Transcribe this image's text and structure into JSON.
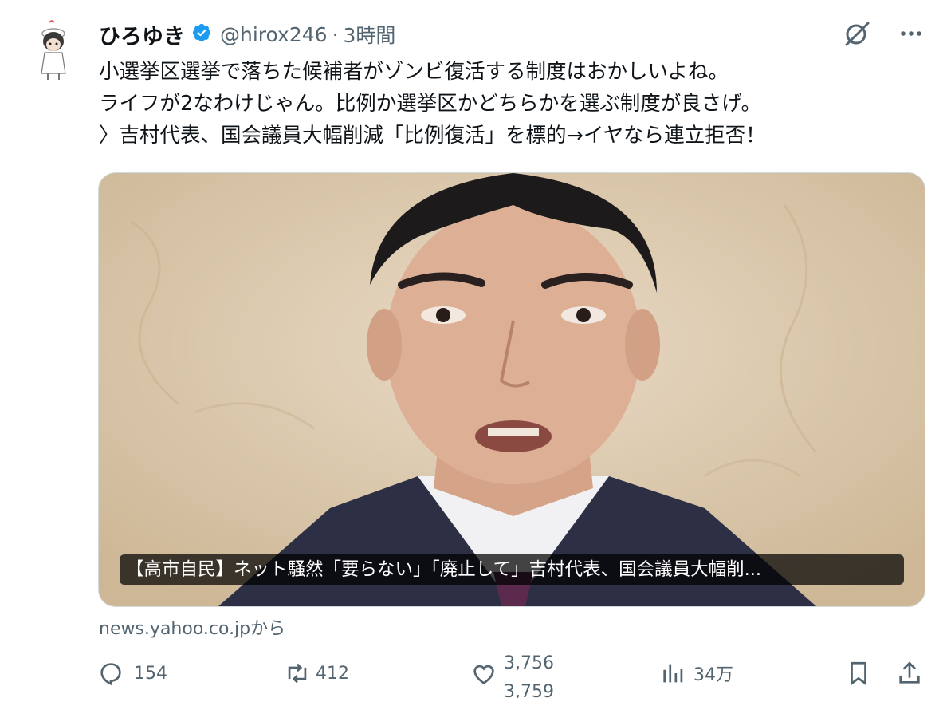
{
  "user": {
    "display_name": "ひろゆき",
    "handle": "@hirox246",
    "separator": "·",
    "time": "3時間"
  },
  "tweet": {
    "lines": [
      "小選挙区選挙で落ちた候補者がゾンビ復活する制度はおかしいよね。",
      "ライフが2なわけじゃん。比例か選挙区かどちらかを選ぶ制度が良さげ。",
      "〉吉村代表、国会議員大幅削減「比例復活」を標的→イヤなら連立拒否！"
    ]
  },
  "card": {
    "caption": "【高市自民】ネット騒然「要らない」「廃止して」吉村代表、国会議員大幅削...",
    "source": "news.yahoo.co.jpから"
  },
  "actions": {
    "reply_count": "154",
    "retweet_count": "412",
    "like_count": "3,756",
    "like_count_next": "3,759",
    "views_count": "34万"
  },
  "icons": {
    "verified": "verified-badge-icon",
    "grok": "grok-icon",
    "more": "more-icon",
    "reply": "reply-icon",
    "retweet": "retweet-icon",
    "like": "like-icon",
    "views": "views-icon",
    "bookmark": "bookmark-icon",
    "share": "share-icon"
  },
  "colors": {
    "text": "#0f1419",
    "secondary": "#536471",
    "verified": "#1d9bf0"
  }
}
